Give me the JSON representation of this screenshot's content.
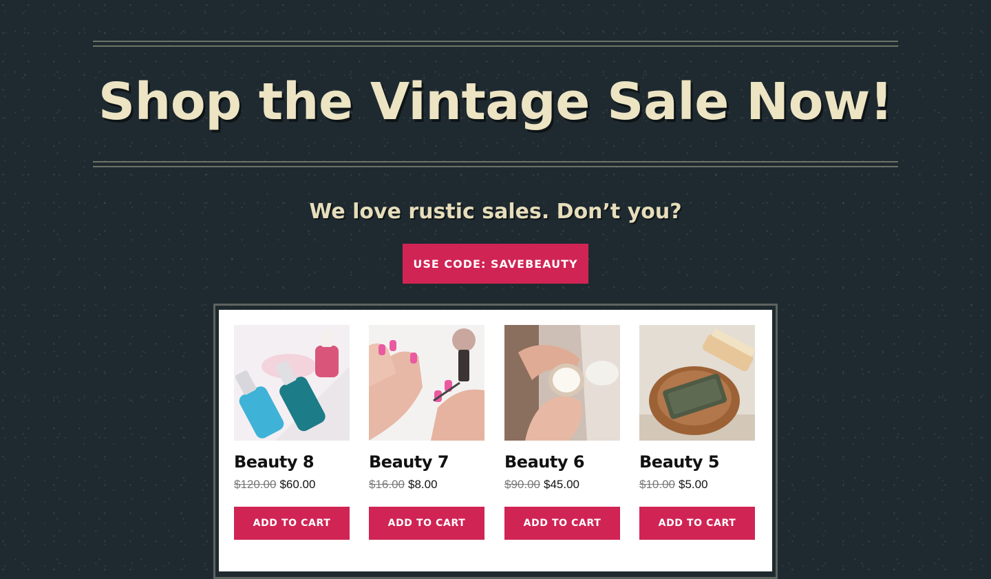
{
  "hero": {
    "headline": "Shop the Vintage Sale Now!",
    "subheadline": "We love rustic sales. Don’t you?",
    "code_button": "USE CODE: SAVEBEAUTY"
  },
  "products": [
    {
      "name": "Beauty 8",
      "old_price": "$120.00",
      "price": "$60.00",
      "cart_label": "ADD TO CART",
      "image": "serum-bottles-photo"
    },
    {
      "name": "Beauty 7",
      "old_price": "$16.00",
      "price": "$8.00",
      "cart_label": "ADD TO CART",
      "image": "nail-polish-photo"
    },
    {
      "name": "Beauty 6",
      "old_price": "$90.00",
      "price": "$45.00",
      "cart_label": "ADD TO CART",
      "image": "face-cream-photo"
    },
    {
      "name": "Beauty 5",
      "old_price": "$10.00",
      "price": "$5.00",
      "cart_label": "ADD TO CART",
      "image": "soap-bar-photo"
    }
  ],
  "colors": {
    "background": "#1f2a30",
    "headline": "#ece4c3",
    "accent": "#d02454"
  }
}
